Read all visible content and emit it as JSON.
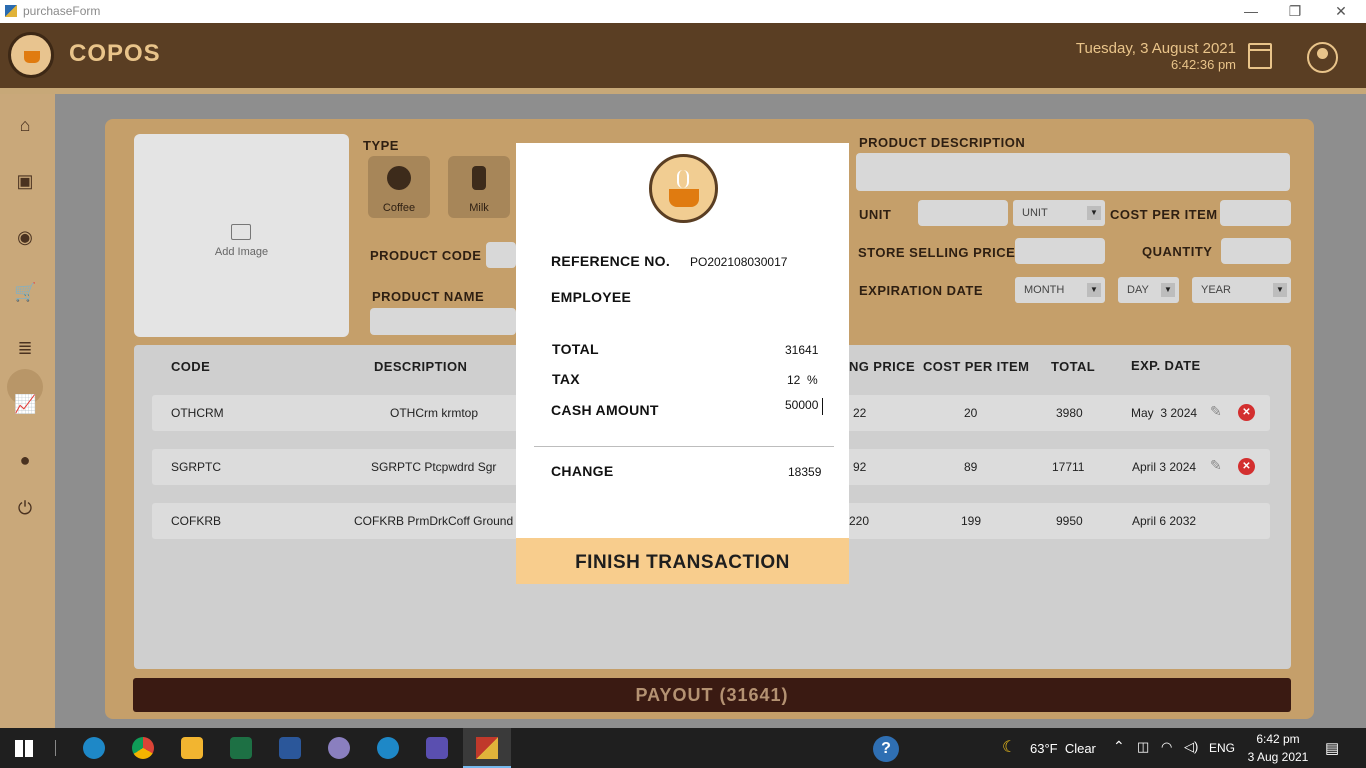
{
  "window": {
    "title": "purchaseForm",
    "minimize_glyph": "—",
    "restore_glyph": "❐",
    "close_glyph": "✕"
  },
  "header": {
    "brand": "COPOS",
    "date": "Tuesday, 3 August 2021",
    "time": "6:42:36 pm"
  },
  "sidebar": {
    "items": [
      {
        "icon": "home-icon",
        "glyph": "⌂"
      },
      {
        "icon": "box-icon",
        "glyph": "▣"
      },
      {
        "icon": "coin-icon",
        "glyph": "◉"
      },
      {
        "icon": "cart-icon",
        "glyph": "🛒"
      },
      {
        "icon": "list-icon",
        "glyph": "≣"
      },
      {
        "icon": "chart-icon",
        "glyph": "📈"
      },
      {
        "icon": "user-icon",
        "glyph": "●"
      },
      {
        "icon": "power-icon",
        "glyph": "⏻"
      }
    ]
  },
  "form": {
    "add_image": "Add Image",
    "type_label": "TYPE",
    "types": [
      {
        "label": "Coffee"
      },
      {
        "label": "Milk"
      }
    ],
    "product_code_label": "PRODUCT CODE",
    "product_name_label": "PRODUCT NAME",
    "product_description_label": "PRODUCT DESCRIPTION",
    "unit_label": "UNIT",
    "unit_select": "UNIT",
    "cost_per_item_label": "COST PER ITEM",
    "store_selling_price_label": "STORE SELLING PRICE",
    "quantity_label": "QUANTITY",
    "expiration_date_label": "EXPIRATION DATE",
    "month_select": "MONTH",
    "day_select": "DAY",
    "year_select": "YEAR"
  },
  "table": {
    "headers": {
      "code": "CODE",
      "description": "DESCRIPTION",
      "price_partial": "NG PRICE",
      "cost_per_item": "COST PER ITEM",
      "total": "TOTAL",
      "exp_date": "EXP. DATE"
    },
    "rows": [
      {
        "code": "OTHCRM",
        "description": "OTHCrm krmtop",
        "price": "22",
        "cost": "20",
        "total": "3980",
        "exp": "May  3 2024"
      },
      {
        "code": "SGRPTC",
        "description": "SGRPTC Ptcpwdrd Sgr",
        "price": "92",
        "cost": "89",
        "total": "17711",
        "exp": "April 3 2024"
      },
      {
        "code": "COFKRB",
        "description": "COFKRB PrmDrkCoff Ground",
        "price": "220",
        "cost": "199",
        "total": "9950",
        "exp": "April 6 2032"
      }
    ]
  },
  "payout": {
    "label": "PAYOUT (31641)"
  },
  "modal": {
    "reference_label": "REFERENCE NO.",
    "reference_value": "PO202108030017",
    "employee_label": "EMPLOYEE",
    "employee_value": "",
    "total_label": "TOTAL",
    "total_value": "31641",
    "tax_label": "TAX",
    "tax_value": "12  %",
    "cash_label": "CASH AMOUNT",
    "cash_value": "50000",
    "change_label": "CHANGE",
    "change_value": "18359",
    "finish_button": "FINISH TRANSACTION"
  },
  "taskbar": {
    "weather": "63°F  Clear",
    "language": "ENG",
    "time": "6:42 pm",
    "date": "3 Aug 2021"
  },
  "colors": {
    "header_brown": "#5a3e23",
    "panel_tan": "#c59f6a",
    "finish_peach": "#f8cd8d",
    "payout_dark": "#3a1a12",
    "delete_red": "#d32f2f"
  }
}
